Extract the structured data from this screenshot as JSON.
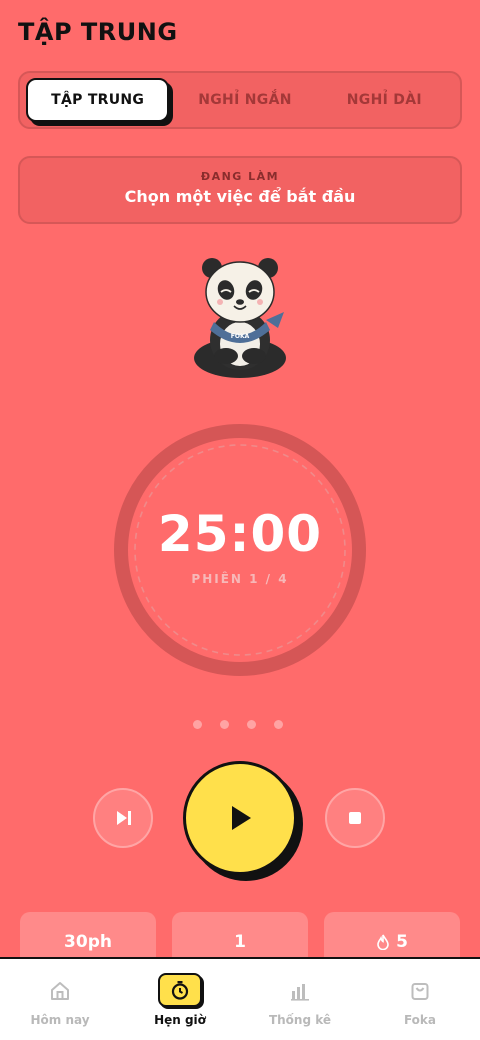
{
  "header": {
    "title": "TẬP TRUNG"
  },
  "mode_tabs": [
    {
      "label": "TẬP TRUNG",
      "active": true
    },
    {
      "label": "NGHỈ NGẮN",
      "active": false
    },
    {
      "label": "NGHỈ DÀI",
      "active": false
    }
  ],
  "current_task": {
    "label": "ĐANG LÀM",
    "text": "Chọn một việc để bắt đầu"
  },
  "mascot": {
    "badge_text": "FOKA"
  },
  "timer": {
    "time": "25:00",
    "session": "PHIÊN 1 / 4",
    "sessions_total": 4,
    "sessions_completed": 0
  },
  "controls": {
    "skip_icon": "skip-next-icon",
    "play_icon": "play-icon",
    "stop_icon": "stop-icon"
  },
  "stats": {
    "duration": "30ph",
    "count": "1",
    "streak": "5",
    "streak_icon": "flame-icon"
  },
  "nav": [
    {
      "label": "Hôm nay",
      "icon": "home-icon",
      "active": false
    },
    {
      "label": "Hẹn giờ",
      "icon": "timer-icon",
      "active": true
    },
    {
      "label": "Thống kê",
      "icon": "chart-icon",
      "active": false
    },
    {
      "label": "Foka",
      "icon": "bag-icon",
      "active": false
    }
  ],
  "colors": {
    "background": "#ff6b6b",
    "accent": "#ffe04b",
    "ink": "#111111"
  }
}
